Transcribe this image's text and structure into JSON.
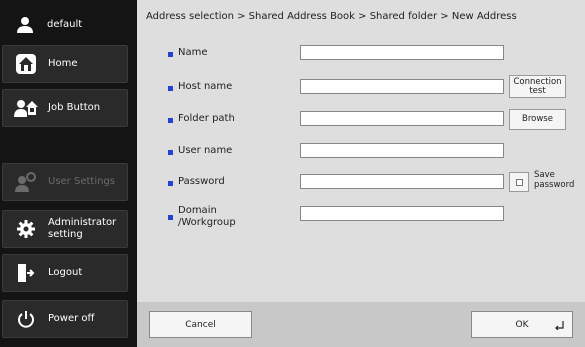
{
  "sidebar": {
    "user": "default",
    "items": [
      {
        "label": "Home",
        "icon": "home-icon"
      },
      {
        "label": "Job Button",
        "icon": "job-button-icon"
      },
      {
        "label": "User Settings",
        "icon": "user-settings-icon",
        "disabled": true
      },
      {
        "label": "Administrator setting",
        "icon": "gear-icon"
      },
      {
        "label": "Logout",
        "icon": "logout-icon"
      },
      {
        "label": "Power off",
        "icon": "power-icon"
      }
    ]
  },
  "breadcrumb": "Address selection > Shared Address Book > Shared folder > New Address",
  "form": {
    "name": {
      "label": "Name",
      "value": ""
    },
    "host_name": {
      "label": "Host name",
      "value": "",
      "button": "Connection test"
    },
    "folder_path": {
      "label": "Folder path",
      "value": "",
      "button": "Browse"
    },
    "user_name": {
      "label": "User name",
      "value": ""
    },
    "password": {
      "label": "Password",
      "value": "",
      "checkbox_label": "Save password",
      "checked": false
    },
    "domain": {
      "label": "Domain /Workgroup",
      "value": ""
    }
  },
  "footer": {
    "cancel": "Cancel",
    "ok": "OK"
  },
  "colors": {
    "bullet": "#2244cc",
    "sidebar_bg": "#141414",
    "main_bg": "#dedede"
  }
}
